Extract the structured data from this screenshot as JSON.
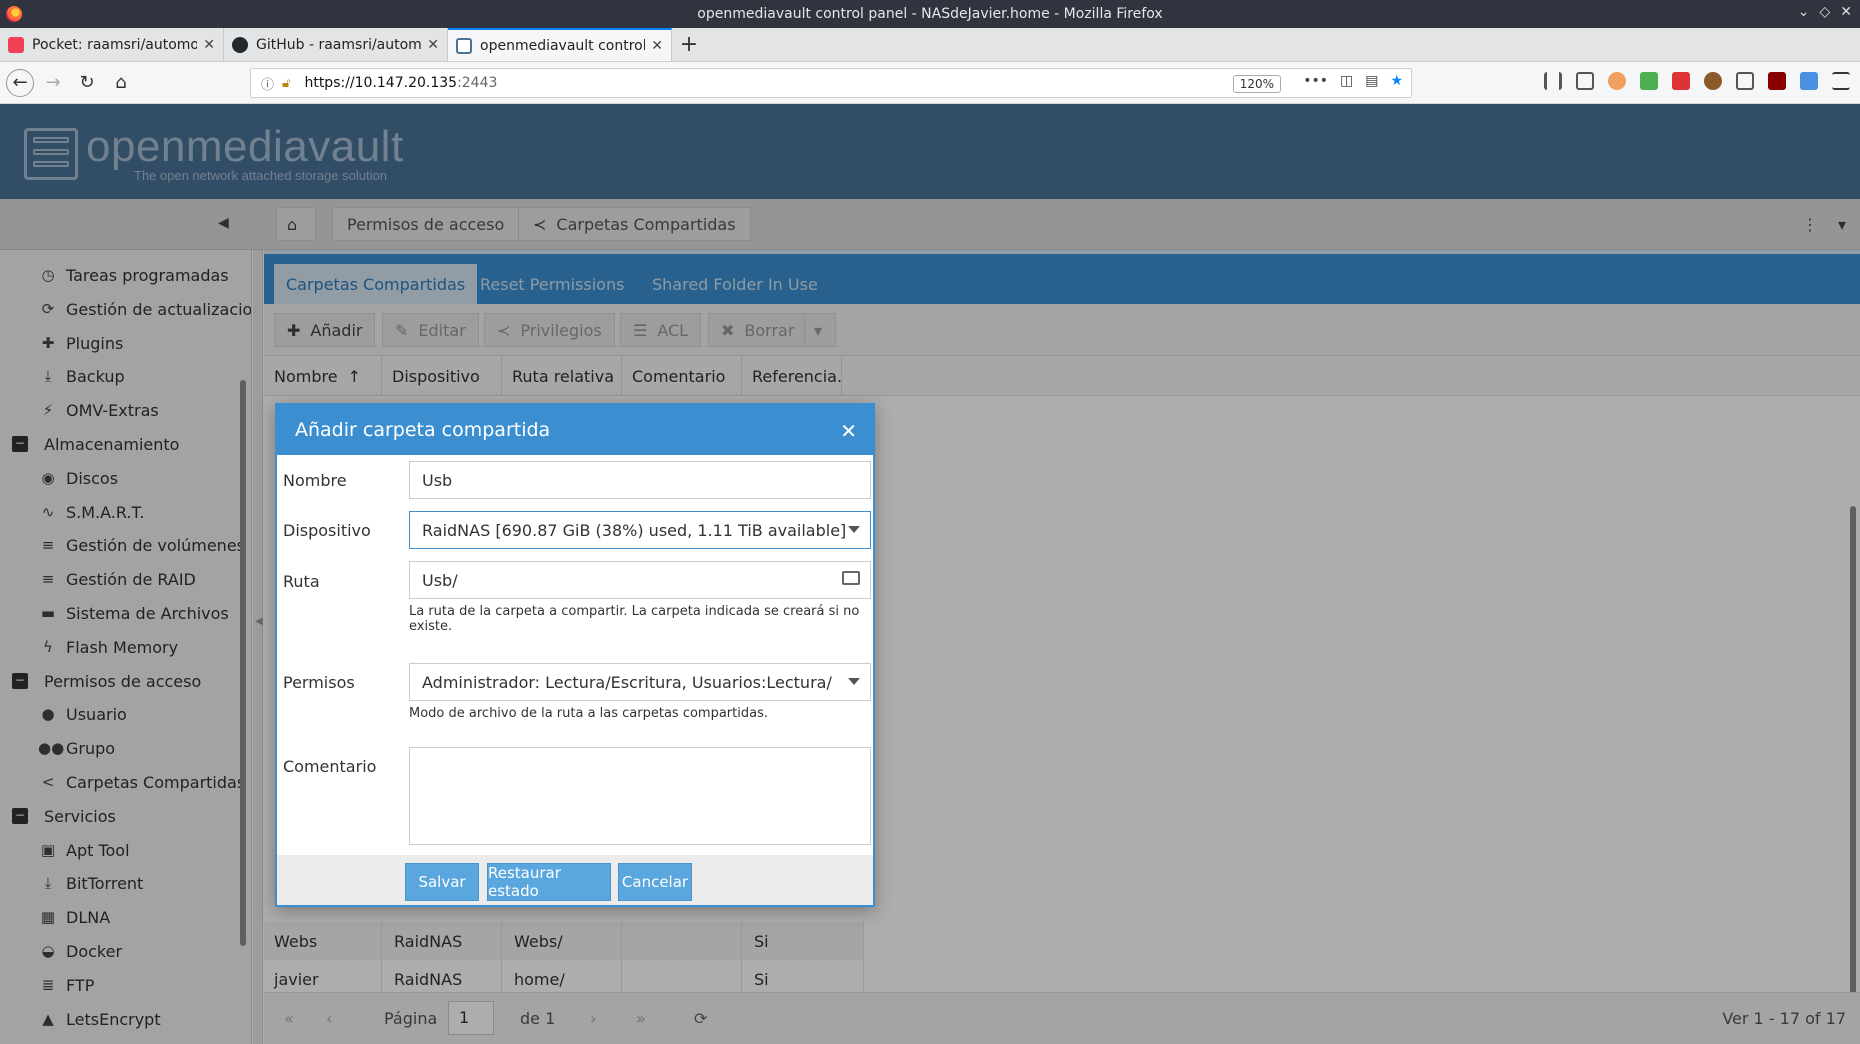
{
  "browser": {
    "window_title": "openmediavault control panel - NASdeJavier.home - Mozilla Firefox",
    "tabs": [
      {
        "label": "Pocket: raamsri/automour",
        "icon": "pocket-icon",
        "color": "#ef4056"
      },
      {
        "label": "GitHub - raamsri/automou",
        "icon": "github-icon",
        "color": "#24292e"
      },
      {
        "label": "openmediavault control pa",
        "icon": "page-icon",
        "color": "#4a7297"
      }
    ],
    "url_host": "https://10.147.20.135",
    "url_port": ":2443",
    "zoom": "120%"
  },
  "omv": {
    "brand": "openmediavault",
    "tagline": "The open network attached storage solution"
  },
  "breadcrumb": {
    "items": [
      "Permisos de acceso",
      "Carpetas Compartidas"
    ]
  },
  "sidebar": {
    "items": [
      {
        "label": "Tareas programadas",
        "icon": "clock-icon",
        "glyph": "◷",
        "group": false
      },
      {
        "label": "Gestión de actualizacion",
        "icon": "refresh-icon",
        "glyph": "⟳",
        "group": false
      },
      {
        "label": "Plugins",
        "icon": "puzzle-icon",
        "glyph": "✚",
        "group": false
      },
      {
        "label": "Backup",
        "icon": "download-icon",
        "glyph": "⤓",
        "group": false
      },
      {
        "label": "OMV-Extras",
        "icon": "plug-icon",
        "glyph": "⚡",
        "group": false
      },
      {
        "label": "Almacenamiento",
        "icon": "collapse-icon",
        "glyph": "−",
        "group": true
      },
      {
        "label": "Discos",
        "icon": "disk-icon",
        "glyph": "◉",
        "group": false
      },
      {
        "label": "S.M.A.R.T.",
        "icon": "heartbeat-icon",
        "glyph": "∿",
        "group": false
      },
      {
        "label": "Gestión de volúmenes l",
        "icon": "database-icon",
        "glyph": "≡",
        "group": false
      },
      {
        "label": "Gestión de RAID",
        "icon": "database-icon",
        "glyph": "≡",
        "group": false
      },
      {
        "label": "Sistema de Archivos",
        "icon": "folder-icon",
        "glyph": "▬",
        "group": false
      },
      {
        "label": "Flash Memory",
        "icon": "bolt-icon",
        "glyph": "ϟ",
        "group": false
      },
      {
        "label": "Permisos de acceso",
        "icon": "collapse-icon",
        "glyph": "−",
        "group": true
      },
      {
        "label": "Usuario",
        "icon": "user-icon",
        "glyph": "●",
        "group": false
      },
      {
        "label": "Grupo",
        "icon": "users-icon",
        "glyph": "●●",
        "group": false
      },
      {
        "label": "Carpetas Compartidas",
        "icon": "share-icon",
        "glyph": "<",
        "group": false
      },
      {
        "label": "Servicios",
        "icon": "collapse-icon",
        "glyph": "−",
        "group": true
      },
      {
        "label": "Apt Tool",
        "icon": "box-icon",
        "glyph": "▣",
        "group": false
      },
      {
        "label": "BitTorrent",
        "icon": "download-icon",
        "glyph": "⤓",
        "group": false
      },
      {
        "label": "DLNA",
        "icon": "film-icon",
        "glyph": "▦",
        "group": false
      },
      {
        "label": "Docker",
        "icon": "docker-icon",
        "glyph": "◒",
        "group": false
      },
      {
        "label": "FTP",
        "icon": "server-icon",
        "glyph": "≣",
        "group": false
      },
      {
        "label": "LetsEncrypt",
        "icon": "lock-icon",
        "glyph": "▲",
        "group": false
      }
    ]
  },
  "main": {
    "tabs": [
      "Carpetas Compartidas",
      "Reset Permissions",
      "Shared Folder In Use"
    ],
    "toolbar": {
      "add": "Añadir",
      "edit": "Editar",
      "privileges": "Privilegios",
      "acl": "ACL",
      "delete": "Borrar"
    },
    "columns": [
      "Nombre",
      "Dispositivo",
      "Ruta relativa",
      "Comentario",
      "Referencia..."
    ],
    "rows": [
      {
        "name": "Webs",
        "device": "RaidNAS",
        "path": "Webs/",
        "comment": "",
        "ref": "Si"
      },
      {
        "name": "javier",
        "device": "RaidNAS",
        "path": "home/",
        "comment": "",
        "ref": "Si"
      }
    ],
    "pager": {
      "page_label": "Página",
      "page": "1",
      "of_label": "de 1",
      "summary": "Ver 1 - 17 of 17"
    }
  },
  "dialog": {
    "title": "Añadir carpeta compartida",
    "fields": {
      "name_label": "Nombre",
      "name_value": "Usb",
      "device_label": "Dispositivo",
      "device_value": "RaidNAS [690.87 GiB (38%) used, 1.11 TiB available]",
      "path_label": "Ruta",
      "path_value": "Usb/",
      "path_hint": "La ruta de la carpeta a compartir. La carpeta indicada se creará si no existe.",
      "perm_label": "Permisos",
      "perm_value": "Administrador: Lectura/Escritura, Usuarios:Lectura/Esc",
      "perm_hint": "Modo de archivo de la ruta a las carpetas compartidas.",
      "comment_label": "Comentario",
      "comment_value": ""
    },
    "buttons": {
      "save": "Salvar",
      "reset": "Restaurar estado",
      "cancel": "Cancelar"
    }
  },
  "colors": {
    "header": "#4a7297",
    "accent": "#3b8fd0",
    "button": "#5aa6de"
  }
}
